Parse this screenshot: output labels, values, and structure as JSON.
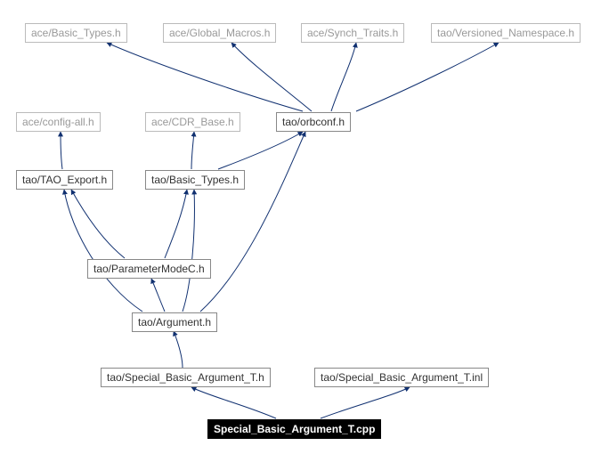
{
  "chart_data": {
    "type": "dependency-graph",
    "title": "",
    "nodes": [
      {
        "id": "root",
        "label": "Special_Basic_Argument_T.cpp"
      },
      {
        "id": "sbath",
        "label": "tao/Special_Basic_Argument_T.h"
      },
      {
        "id": "sbatinl",
        "label": "tao/Special_Basic_Argument_T.inl"
      },
      {
        "id": "argument",
        "label": "tao/Argument.h"
      },
      {
        "id": "parammode",
        "label": "tao/ParameterModeC.h"
      },
      {
        "id": "taoexport",
        "label": "tao/TAO_Export.h"
      },
      {
        "id": "basictypes",
        "label": "tao/Basic_Types.h"
      },
      {
        "id": "orbconf",
        "label": "tao/orbconf.h"
      },
      {
        "id": "configall",
        "label": "ace/config-all.h"
      },
      {
        "id": "cdrbase",
        "label": "ace/CDR_Base.h"
      },
      {
        "id": "acebasic",
        "label": "ace/Basic_Types.h"
      },
      {
        "id": "globalmac",
        "label": "ace/Global_Macros.h"
      },
      {
        "id": "synch",
        "label": "ace/Synch_Traits.h"
      },
      {
        "id": "version",
        "label": "tao/Versioned_Namespace.h"
      }
    ],
    "edges": [
      [
        "root",
        "sbath"
      ],
      [
        "root",
        "sbatinl"
      ],
      [
        "sbath",
        "argument"
      ],
      [
        "argument",
        "taoexport"
      ],
      [
        "argument",
        "basictypes"
      ],
      [
        "argument",
        "orbconf"
      ],
      [
        "argument",
        "parammode"
      ],
      [
        "parammode",
        "taoexport"
      ],
      [
        "parammode",
        "basictypes"
      ],
      [
        "basictypes",
        "cdrbase"
      ],
      [
        "basictypes",
        "orbconf"
      ],
      [
        "taoexport",
        "configall"
      ],
      [
        "orbconf",
        "acebasic"
      ],
      [
        "orbconf",
        "globalmac"
      ],
      [
        "orbconf",
        "synch"
      ],
      [
        "orbconf",
        "version"
      ]
    ]
  },
  "nodes": {
    "root": "Special_Basic_Argument_T.cpp",
    "sbath": "tao/Special_Basic_Argument_T.h",
    "sbatinl": "tao/Special_Basic_Argument_T.inl",
    "argument": "tao/Argument.h",
    "parammode": "tao/ParameterModeC.h",
    "taoexport": "tao/TAO_Export.h",
    "basictypes": "tao/Basic_Types.h",
    "orbconf": "tao/orbconf.h",
    "configall": "ace/config-all.h",
    "cdrbase": "ace/CDR_Base.h",
    "acebasic": "ace/Basic_Types.h",
    "globalmac": "ace/Global_Macros.h",
    "synch": "ace/Synch_Traits.h",
    "version": "tao/Versioned_Namespace.h"
  }
}
